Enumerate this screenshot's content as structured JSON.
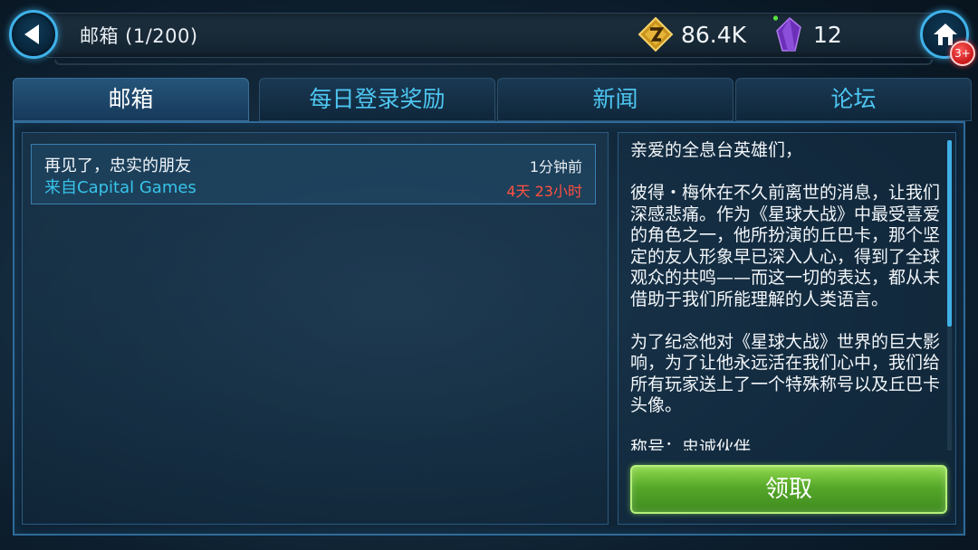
{
  "header": {
    "title": "邮箱 (1/200)",
    "credits_value": "86.4K",
    "crystals_value": "12",
    "notification_badge": "3+"
  },
  "tabs": [
    {
      "label": "邮箱",
      "active": true
    },
    {
      "label": "每日登录奖励",
      "active": false
    },
    {
      "label": "新闻",
      "active": false
    },
    {
      "label": "论坛",
      "active": false
    }
  ],
  "mail_list": [
    {
      "subject": "再见了，忠实的朋友",
      "sender": "来自Capital Games",
      "time": "1分钟前",
      "expiry": "4天 23小时"
    }
  ],
  "mail_detail": {
    "body": "亲爱的全息台英雄们，\n\n彼得・梅休在不久前离世的消息，让我们深感悲痛。作为《星球大战》中最受喜爱的角色之一，他所扮演的丘巴卡，那个坚定的友人形象早已深入人心，得到了全球观众的共鸣——而这一切的表达，都从未借助于我们所能理解的人类语言。\n\n为了纪念他对《星球大战》世界的巨大影响，为了让他永远活在我们心中，我们给所有玩家送上了一个特殊称号以及丘巴卡头像。\n\n称号：忠诚伙伴",
    "claim_label": "领取"
  },
  "colors": {
    "accent": "#3fb2ea",
    "expiry": "#ff5040",
    "sender": "#38c3e8",
    "claim": "#56a82a"
  }
}
